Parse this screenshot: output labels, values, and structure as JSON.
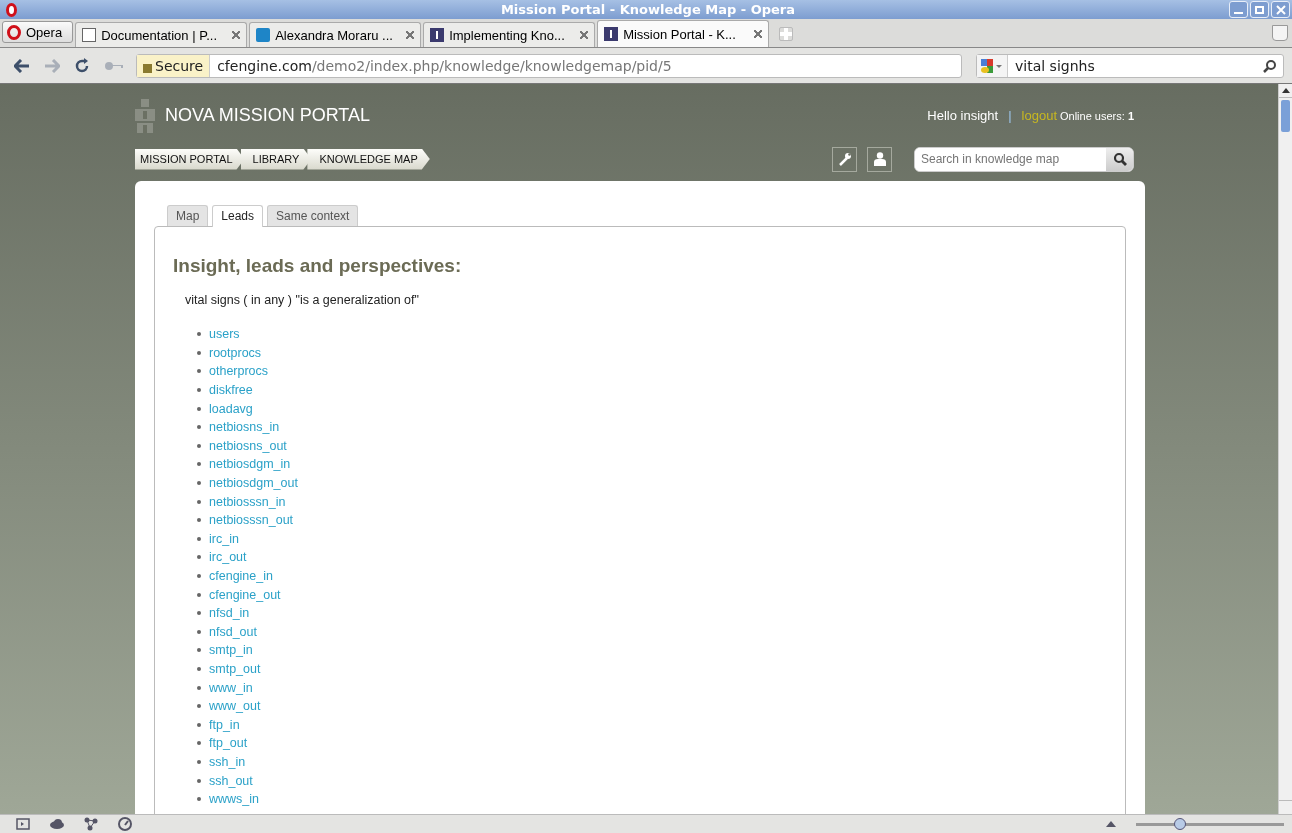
{
  "window": {
    "title": "Mission Portal - Knowledge Map - Opera"
  },
  "browser_tabs": [
    {
      "label": "Opera",
      "kind": "menu",
      "selected": false
    },
    {
      "label": "Documentation | P...",
      "kind": "doc",
      "selected": false
    },
    {
      "label": "Alexandra Moraru ...",
      "kind": "in",
      "selected": false
    },
    {
      "label": "Implementing Kno...",
      "kind": "site",
      "selected": false
    },
    {
      "label": "Mission Portal - K...",
      "kind": "site",
      "selected": true
    }
  ],
  "address_bar": {
    "badge": "Secure",
    "host": "cfengine.com",
    "path": "/demo2/index.php/knowledge/knowledgemap/pid/5"
  },
  "search_bar": {
    "value": "vital signhs"
  },
  "portal": {
    "title": "NOVA MISSION PORTAL",
    "greeting": "Hello insight",
    "separator": "|",
    "logout": "logout",
    "online_label": "Online users:",
    "online_count": "1",
    "breadcrumbs": [
      "MISSION PORTAL",
      "LIBRARY",
      "KNOWLEDGE MAP"
    ],
    "search": {
      "placeholder": "Search in knowledge map"
    }
  },
  "tabs": [
    {
      "label": "Map",
      "selected": false
    },
    {
      "label": "Leads",
      "selected": true
    },
    {
      "label": "Same context",
      "selected": false
    }
  ],
  "leads": {
    "heading": "Insight, leads and perspectives:",
    "statement": "vital signs ( in any ) \"is a generalization of\"",
    "items": [
      "users",
      "rootprocs",
      "otherprocs",
      "diskfree",
      "loadavg",
      "netbiosns_in",
      "netbiosns_out",
      "netbiosdgm_in",
      "netbiosdgm_out",
      "netbiosssn_in",
      "netbiosssn_out",
      "irc_in",
      "irc_out",
      "cfengine_in",
      "cfengine_out",
      "nfsd_in",
      "nfsd_out",
      "smtp_in",
      "smtp_out",
      "www_in",
      "www_out",
      "ftp_in",
      "ftp_out",
      "ssh_in",
      "ssh_out",
      "wwws_in"
    ]
  },
  "zoom": {
    "level": 0.3
  }
}
